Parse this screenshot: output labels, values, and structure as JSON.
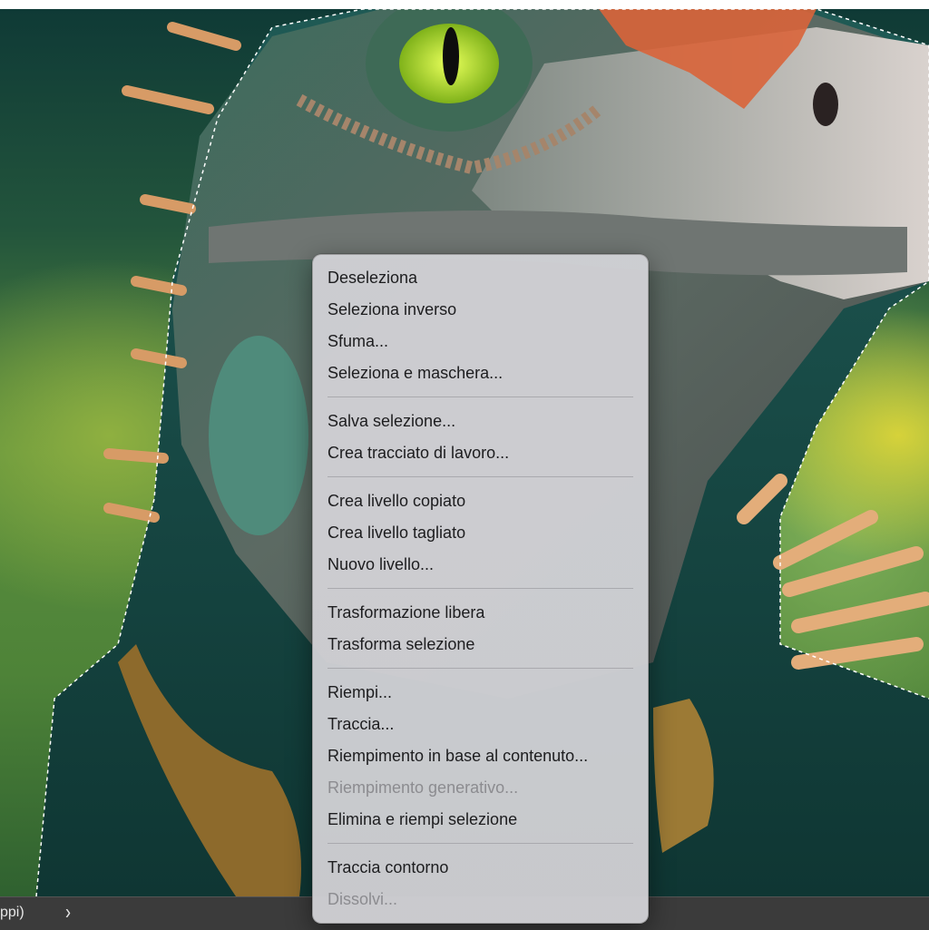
{
  "colors": {
    "menu_background": "#d0d0d4",
    "menu_text": "#1d1d1f",
    "menu_text_disabled": "#8c8c90",
    "status_bar": "#3b3b3b"
  },
  "status_bar": {
    "text": "ppi)",
    "arrow": "›"
  },
  "context_menu": {
    "groups": [
      [
        {
          "label": "Deseleziona",
          "enabled": true
        },
        {
          "label": "Seleziona inverso",
          "enabled": true
        },
        {
          "label": "Sfuma...",
          "enabled": true
        },
        {
          "label": "Seleziona e maschera...",
          "enabled": true
        }
      ],
      [
        {
          "label": "Salva selezione...",
          "enabled": true
        },
        {
          "label": "Crea tracciato di lavoro...",
          "enabled": true
        }
      ],
      [
        {
          "label": "Crea livello copiato",
          "enabled": true
        },
        {
          "label": "Crea livello tagliato",
          "enabled": true
        },
        {
          "label": "Nuovo livello...",
          "enabled": true
        }
      ],
      [
        {
          "label": "Trasformazione libera",
          "enabled": true
        },
        {
          "label": "Trasforma selezione",
          "enabled": true
        }
      ],
      [
        {
          "label": "Riempi...",
          "enabled": true
        },
        {
          "label": "Traccia...",
          "enabled": true
        },
        {
          "label": "Riempimento in base al contenuto...",
          "enabled": true
        },
        {
          "label": "Riempimento generativo...",
          "enabled": false
        },
        {
          "label": "Elimina e riempi selezione",
          "enabled": true
        }
      ],
      [
        {
          "label": "Traccia contorno",
          "enabled": true
        },
        {
          "label": "Dissolvi...",
          "enabled": false
        }
      ]
    ]
  }
}
